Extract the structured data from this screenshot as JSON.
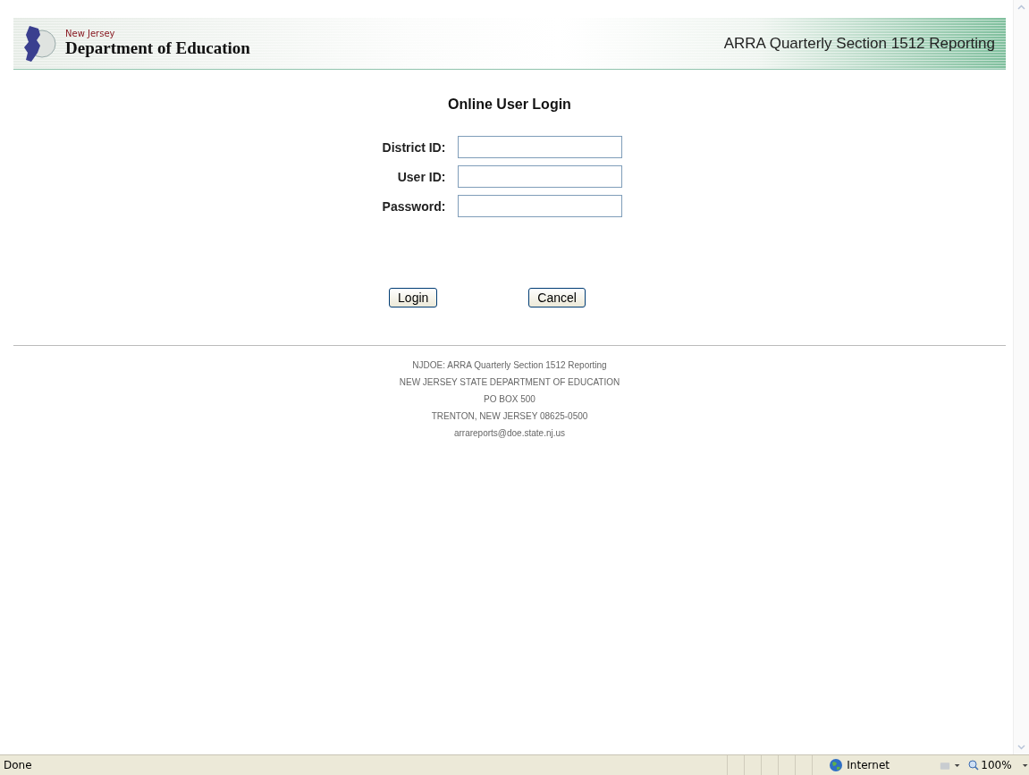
{
  "header": {
    "state_name": "New Jersey",
    "department": "Department of Education",
    "app_title": "ARRA Quarterly Section 1512 Reporting"
  },
  "login": {
    "title": "Online User Login",
    "fields": [
      {
        "label": "District ID:"
      },
      {
        "label": "User ID:"
      },
      {
        "label": "Password:"
      }
    ],
    "buttons": [
      "Login",
      "Cancel"
    ]
  },
  "footer": [
    "NJDOE: ARRA Quarterly Section 1512 Reporting",
    "NEW JERSEY STATE DEPARTMENT OF EDUCATION",
    "PO BOX 500",
    "TRENTON, NEW JERSEY 08625-0500",
    "arrareports@doe.state.nj.us"
  ],
  "status_bar": {
    "status": "Done",
    "zone": "Internet",
    "zoom": "100%"
  }
}
